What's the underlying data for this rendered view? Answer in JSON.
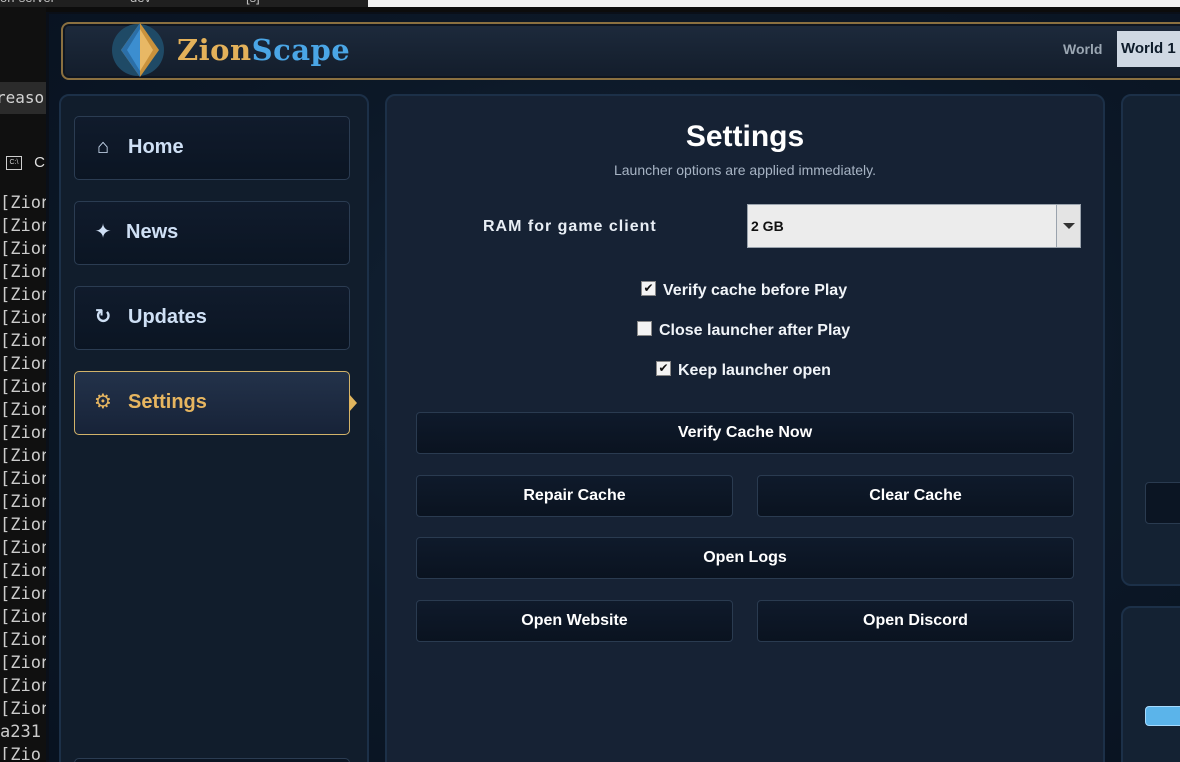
{
  "background": {
    "topbar": [
      "on-server",
      "dev",
      "[s]"
    ],
    "search_text": "reaso",
    "panel_head": "C",
    "cmd_icon_text": "C:\\",
    "log_lines": [
      "[Zion",
      "[Zion",
      "[Zion",
      "[Zion",
      "[Zion",
      "[Zion",
      "[Zion",
      "[Zion",
      "[Zion",
      "[Zion",
      "[Zion",
      "[Zion",
      "[Zion",
      "[Zion",
      "[Zion",
      "[Zion",
      "[Zion",
      "[Zion",
      "[Zion",
      "[Zion",
      "[Zion",
      "[Zion",
      "[Zion",
      "a231",
      "[Zio"
    ]
  },
  "app": {
    "logo_part1": "Zion",
    "logo_part2": "Scape",
    "world_label": "World",
    "world_value": "World 1 -"
  },
  "sidebar": {
    "items": [
      {
        "label": "Home",
        "icon": "home-icon",
        "glyph": "⌂"
      },
      {
        "label": "News",
        "icon": "sparkle-icon",
        "glyph": "✦"
      },
      {
        "label": "Updates",
        "icon": "refresh-icon",
        "glyph": "↻"
      },
      {
        "label": "Settings",
        "icon": "gear-icon",
        "glyph": "⚙",
        "active": true
      }
    ]
  },
  "settings": {
    "title": "Settings",
    "subtitle": "Launcher options are applied immediately.",
    "ram_label": "RAM for game client",
    "ram_value": "2 GB",
    "checkboxes": [
      {
        "label": "Verify cache before Play",
        "checked": true
      },
      {
        "label": "Close launcher after Play",
        "checked": false
      },
      {
        "label": "Keep launcher open",
        "checked": true
      }
    ],
    "buttons": {
      "verify_now": "Verify Cache Now",
      "repair": "Repair Cache",
      "clear": "Clear Cache",
      "logs": "Open Logs",
      "website": "Open Website",
      "discord": "Open Discord"
    }
  },
  "colors": {
    "accent_gold": "#e7b660",
    "accent_blue": "#4aa6e6",
    "panel_bg": "#162234"
  }
}
